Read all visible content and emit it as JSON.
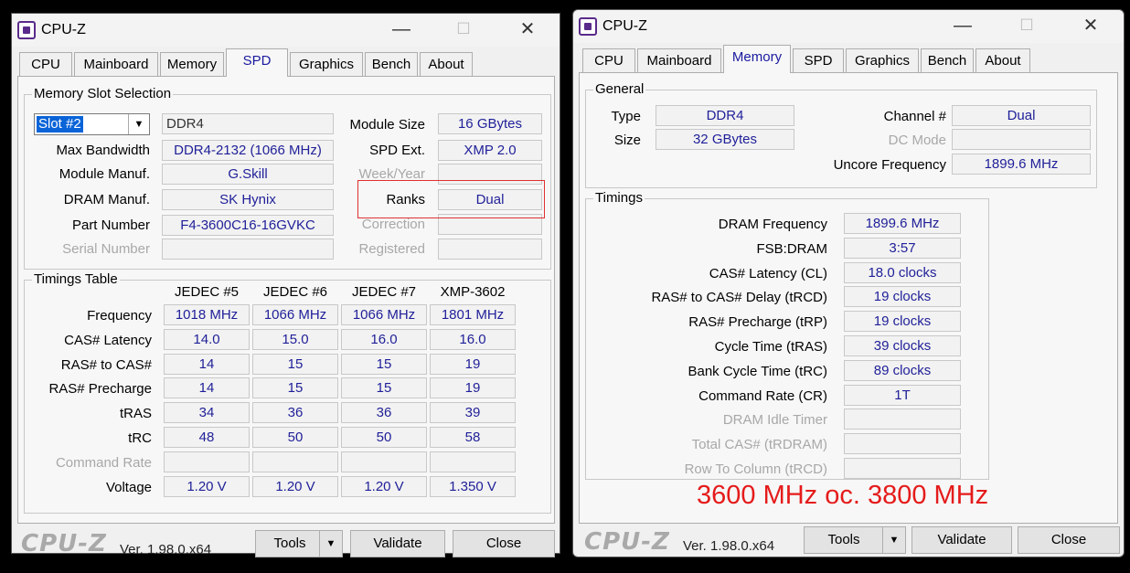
{
  "left_window": {
    "title": "CPU-Z",
    "tabs": [
      "CPU",
      "Mainboard",
      "Memory",
      "SPD",
      "Graphics",
      "Bench",
      "About"
    ],
    "active_tab": "SPD",
    "slot_group_label": "Memory Slot Selection",
    "slot_select_value": "Slot #2",
    "memory_type": "DDR4",
    "labels": {
      "max_bandwidth": "Max Bandwidth",
      "module_manuf": "Module Manuf.",
      "dram_manuf": "DRAM Manuf.",
      "part_number": "Part Number",
      "serial_number": "Serial Number",
      "module_size": "Module Size",
      "spd_ext": "SPD Ext.",
      "week_year": "Week/Year",
      "ranks": "Ranks",
      "correction": "Correction",
      "registered": "Registered"
    },
    "values": {
      "max_bandwidth": "DDR4-2132 (1066 MHz)",
      "module_manuf": "G.Skill",
      "dram_manuf": "SK Hynix",
      "part_number": "F4-3600C16-16GVKC",
      "serial_number": "",
      "module_size": "16 GBytes",
      "spd_ext": "XMP 2.0",
      "week_year": "",
      "ranks": "Dual",
      "correction": "",
      "registered": ""
    },
    "timings_group_label": "Timings Table",
    "timings_columns": [
      "JEDEC #5",
      "JEDEC #6",
      "JEDEC #7",
      "XMP-3602"
    ],
    "timings_rows": [
      {
        "label": "Frequency",
        "values": [
          "1018 MHz",
          "1066 MHz",
          "1066 MHz",
          "1801 MHz"
        ]
      },
      {
        "label": "CAS# Latency",
        "values": [
          "14.0",
          "15.0",
          "16.0",
          "16.0"
        ]
      },
      {
        "label": "RAS# to CAS#",
        "values": [
          "14",
          "15",
          "15",
          "19"
        ]
      },
      {
        "label": "RAS# Precharge",
        "values": [
          "14",
          "15",
          "15",
          "19"
        ]
      },
      {
        "label": "tRAS",
        "values": [
          "34",
          "36",
          "36",
          "39"
        ]
      },
      {
        "label": "tRC",
        "values": [
          "48",
          "50",
          "50",
          "58"
        ]
      },
      {
        "label": "Command Rate",
        "values": [
          "",
          "",
          "",
          ""
        ]
      },
      {
        "label": "Voltage",
        "values": [
          "1.20 V",
          "1.20 V",
          "1.20 V",
          "1.350 V"
        ]
      }
    ],
    "footer": {
      "logo": "CPU-Z",
      "version": "Ver. 1.98.0.x64",
      "tools": "Tools",
      "validate": "Validate",
      "close": "Close"
    }
  },
  "right_window": {
    "title": "CPU-Z",
    "tabs": [
      "CPU",
      "Mainboard",
      "Memory",
      "SPD",
      "Graphics",
      "Bench",
      "About"
    ],
    "active_tab": "Memory",
    "general_label": "General",
    "general": {
      "type_label": "Type",
      "type_value": "DDR4",
      "size_label": "Size",
      "size_value": "32 GBytes",
      "channel_label": "Channel #",
      "channel_value": "Dual",
      "dc_mode_label": "DC Mode",
      "dc_mode_value": "",
      "uncore_label": "Uncore Frequency",
      "uncore_value": "1899.6 MHz"
    },
    "timings_label": "Timings",
    "timings": [
      {
        "label": "DRAM Frequency",
        "value": "1899.6 MHz",
        "dim": false
      },
      {
        "label": "FSB:DRAM",
        "value": "3:57",
        "dim": false
      },
      {
        "label": "CAS# Latency (CL)",
        "value": "18.0 clocks",
        "dim": false
      },
      {
        "label": "RAS# to CAS# Delay (tRCD)",
        "value": "19 clocks",
        "dim": false
      },
      {
        "label": "RAS# Precharge (tRP)",
        "value": "19 clocks",
        "dim": false
      },
      {
        "label": "Cycle Time (tRAS)",
        "value": "39 clocks",
        "dim": false
      },
      {
        "label": "Bank Cycle Time (tRC)",
        "value": "89 clocks",
        "dim": false
      },
      {
        "label": "Command Rate (CR)",
        "value": "1T",
        "dim": false
      },
      {
        "label": "DRAM Idle Timer",
        "value": "",
        "dim": true
      },
      {
        "label": "Total CAS# (tRDRAM)",
        "value": "",
        "dim": true
      },
      {
        "label": "Row To Column (tRCD)",
        "value": "",
        "dim": true
      }
    ],
    "overlay_text": "3600 MHz oc. 3800 MHz",
    "footer": {
      "logo": "CPU-Z",
      "version": "Ver. 1.98.0.x64",
      "tools": "Tools",
      "validate": "Validate",
      "close": "Close"
    }
  },
  "colors": {
    "value_text": "#1f1f99",
    "accent_highlight": "#e03030",
    "overlay_text": "#e51b1b"
  }
}
